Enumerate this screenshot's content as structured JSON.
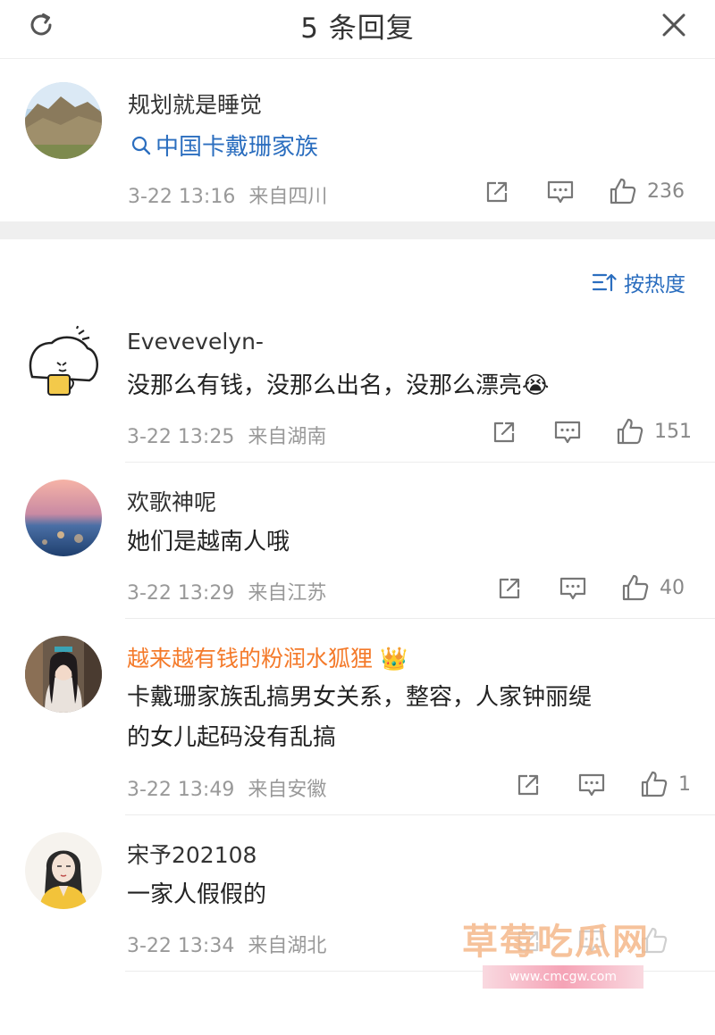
{
  "header": {
    "title": "5 条回复",
    "refresh_icon": "refresh-icon",
    "close_icon": "close-icon"
  },
  "original": {
    "username": "规划就是睡觉",
    "topic": "中国卡戴珊家族",
    "time": "3-22 13:16",
    "location": "来自四川",
    "likes": "236"
  },
  "sort": {
    "label": "按热度"
  },
  "comments": [
    {
      "username": "Evevevelyn-",
      "text": "没那么有钱，没那么出名，没那么漂亮",
      "emoji": "😭",
      "time": "3-22 13:25",
      "location": "来自湖南",
      "likes": "151"
    },
    {
      "username": "欢歌神呢",
      "text": "她们是越南人哦",
      "time": "3-22 13:29",
      "location": "来自江苏",
      "likes": "40"
    },
    {
      "username": "越来越有钱的粉润水狐狸",
      "badge": "👑",
      "text_line1": "卡戴珊家族乱搞男女关系，整容，人家钟丽缇",
      "text_line2": "的女儿起码没有乱搞",
      "time": "3-22 13:49",
      "location": "来自安徽",
      "likes": "1"
    },
    {
      "username": "宋予202108",
      "text": "一家人假假的",
      "time": "3-22 13:34",
      "location": "来自湖北",
      "likes": ""
    }
  ],
  "watermark": {
    "text": "草莓吃瓜网",
    "url": "www.cmcgw.com"
  },
  "colors": {
    "link": "#2b6ebf",
    "vip_name": "#f47a2a",
    "meta": "#999999",
    "band": "#efefef"
  }
}
